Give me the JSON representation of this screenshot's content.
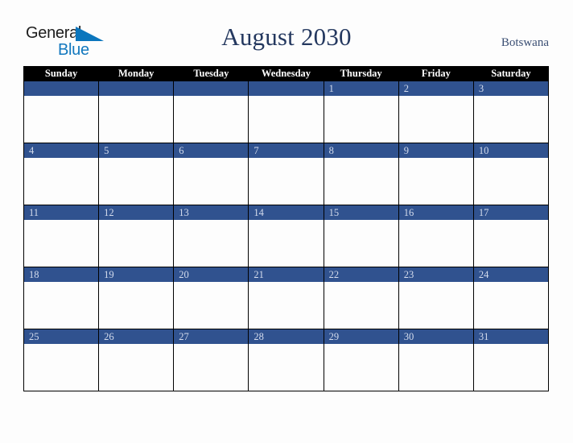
{
  "logo": {
    "word_one": "General",
    "word_two": "Blue",
    "triangle_icon": "triangle-icon",
    "colors": {
      "word_one": "#1d1d1d",
      "word_two": "#1278be",
      "triangle": "#0b76bd"
    }
  },
  "header": {
    "title": "August 2030",
    "month": "August",
    "year": "2030",
    "country": "Botswana"
  },
  "colors": {
    "header_row_bg": "#000000",
    "header_row_text": "#ffffff",
    "date_band_bg": "#30528f",
    "date_band_text": "#d4dced",
    "cell_bg": "#fdfdfd",
    "page_bg": "#fdfdfd",
    "title_text": "#24385f",
    "country_text": "#3a4e73",
    "grid_border": "#000000"
  },
  "calendar": {
    "weekday_headers": [
      "Sunday",
      "Monday",
      "Tuesday",
      "Wednesday",
      "Thursday",
      "Friday",
      "Saturday"
    ],
    "weeks": [
      [
        "",
        "",
        "",
        "",
        "1",
        "2",
        "3"
      ],
      [
        "4",
        "5",
        "6",
        "7",
        "8",
        "9",
        "10"
      ],
      [
        "11",
        "12",
        "13",
        "14",
        "15",
        "16",
        "17"
      ],
      [
        "18",
        "19",
        "20",
        "21",
        "22",
        "23",
        "24"
      ],
      [
        "25",
        "26",
        "27",
        "28",
        "29",
        "30",
        "31"
      ]
    ]
  }
}
